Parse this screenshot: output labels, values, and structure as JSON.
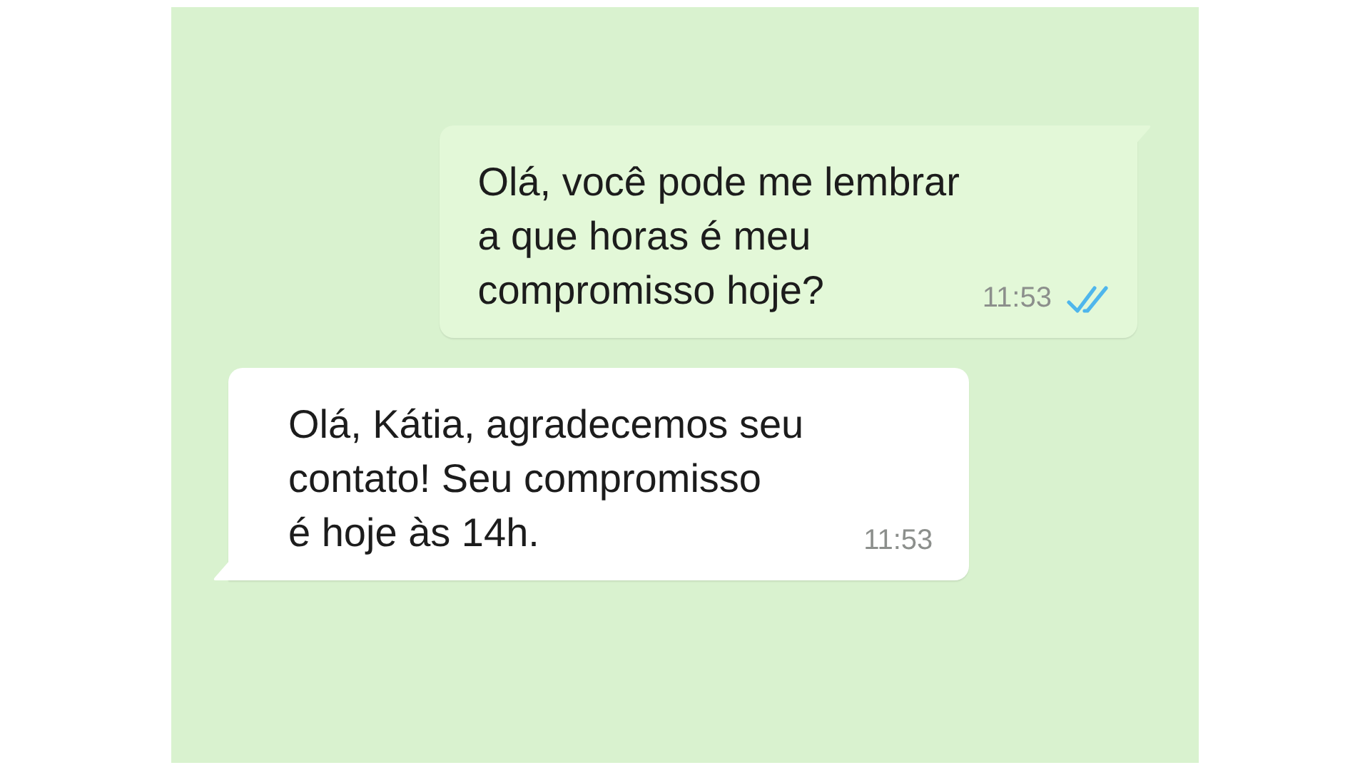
{
  "messages": [
    {
      "kind": "outgoing",
      "text": "Olá, você pode me lembrar\na que horas é meu\ncompromisso hoje?",
      "time": "11:53",
      "read": true
    },
    {
      "kind": "incoming",
      "text": "Olá, Kátia, agradecemos seu\ncontato! Seu compromisso\né hoje às 14h.",
      "time": "11:53"
    }
  ]
}
